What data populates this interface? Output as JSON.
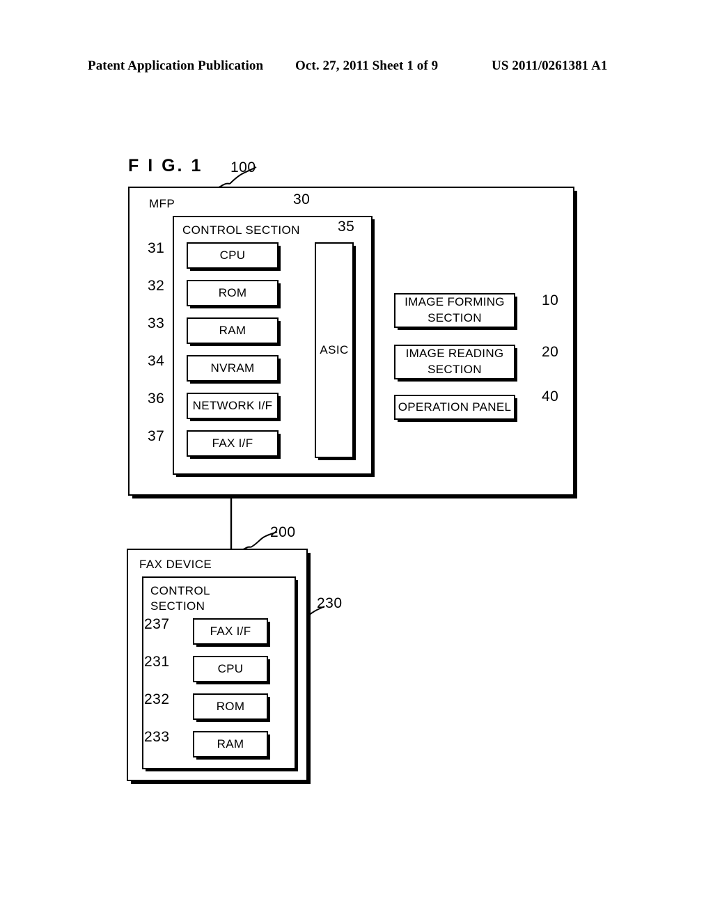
{
  "header": {
    "left": "Patent Application Publication",
    "middle": "Oct. 27, 2011  Sheet 1 of 9",
    "right": "US 2011/0261381 A1"
  },
  "figure": {
    "title": "F I G. 1"
  },
  "mfp": {
    "ref": "100",
    "caption": "MFP",
    "control_section": {
      "ref": "30",
      "caption": "CONTROL SECTION",
      "asic": {
        "ref": "35",
        "label": "ASIC"
      },
      "modules": [
        {
          "ref": "31",
          "label": "CPU"
        },
        {
          "ref": "32",
          "label": "ROM"
        },
        {
          "ref": "33",
          "label": "RAM"
        },
        {
          "ref": "34",
          "label": "NVRAM"
        },
        {
          "ref": "36",
          "label": "NETWORK I/F"
        },
        {
          "ref": "37",
          "label": "FAX I/F"
        }
      ]
    },
    "peripherals": [
      {
        "ref": "10",
        "label": "IMAGE FORMING SECTION",
        "line1": "IMAGE FORMING",
        "line2": "SECTION"
      },
      {
        "ref": "20",
        "label": "IMAGE READING SECTION",
        "line1": "IMAGE READING",
        "line2": "SECTION"
      },
      {
        "ref": "40",
        "label": "OPERATION PANEL",
        "line1": "OPERATION PANEL",
        "line2": ""
      }
    ]
  },
  "fax_device": {
    "ref": "200",
    "caption": "FAX DEVICE",
    "control_section": {
      "ref": "230",
      "caption_line1": "CONTROL",
      "caption_line2": "SECTION",
      "modules": [
        {
          "ref": "237",
          "label": "FAX I/F"
        },
        {
          "ref": "231",
          "label": "CPU"
        },
        {
          "ref": "232",
          "label": "ROM"
        },
        {
          "ref": "233",
          "label": "RAM"
        }
      ]
    }
  },
  "colors": {
    "ink": "#000000",
    "paper": "#ffffff"
  }
}
